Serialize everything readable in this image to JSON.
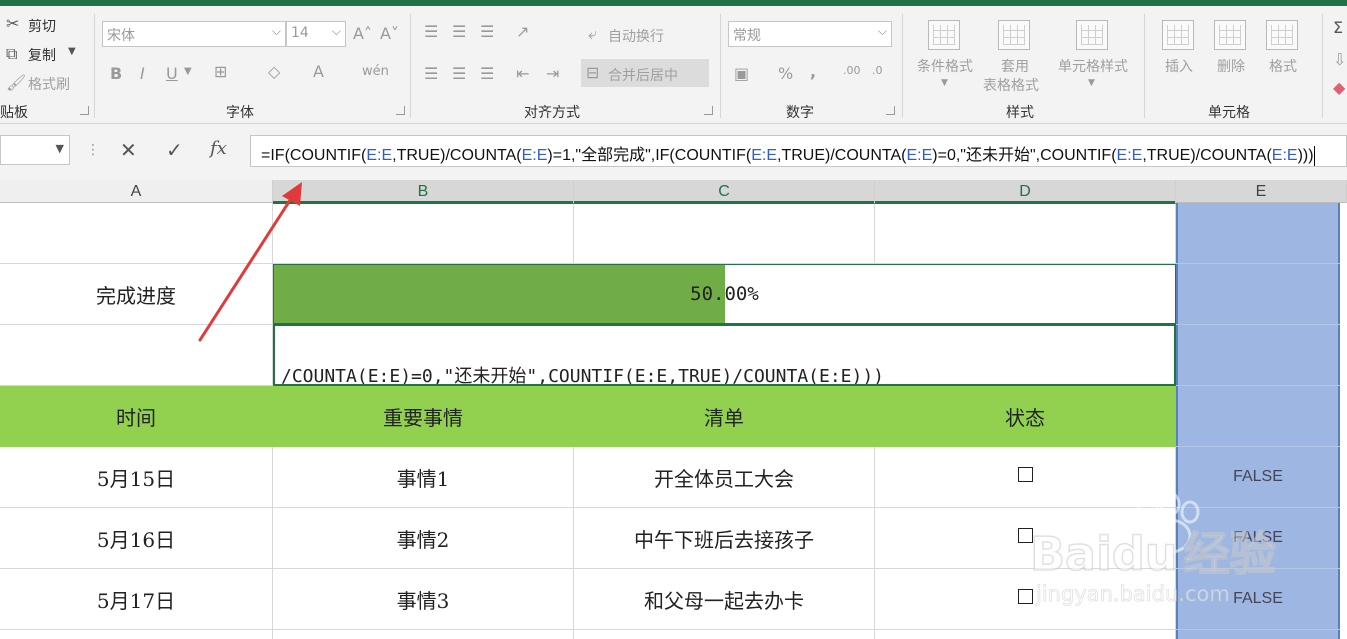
{
  "ribbon": {
    "clipboard": {
      "cut": "剪切",
      "copy": "复制",
      "format_painter": "格式刷",
      "group_label": "贴板"
    },
    "font": {
      "font_name": "宋体",
      "font_size": "14",
      "bold": "B",
      "italic": "I",
      "underline": "U",
      "font_color": "A",
      "phonetic": "wén",
      "group_label": "字体"
    },
    "alignment": {
      "wrap_text": "自动换行",
      "merge_center": "合并后居中",
      "group_label": "对齐方式"
    },
    "number": {
      "format": "常规",
      "percent": "%",
      "comma": ",",
      "group_label": "数字"
    },
    "styles": {
      "conditional_format": "条件格式",
      "table_format_line1": "套用",
      "table_format_line2": "表格格式",
      "cell_styles": "单元格样式",
      "group_label": "样式"
    },
    "cells": {
      "insert": "插入",
      "delete": "删除",
      "format": "格式",
      "group_label": "单元格"
    }
  },
  "formula_bar": {
    "fx": "fx",
    "formula_parts": [
      {
        "t": "=IF(COUNTIF(",
        "ref": false
      },
      {
        "t": "E:E",
        "ref": true
      },
      {
        "t": ",TRUE)/COUNTA(",
        "ref": false
      },
      {
        "t": "E:E",
        "ref": true
      },
      {
        "t": ")=1,\"全部完成\",IF(COUNTIF(",
        "ref": false
      },
      {
        "t": "E:E",
        "ref": true
      },
      {
        "t": ",TRUE)/COUNTA(",
        "ref": false
      },
      {
        "t": "E:E",
        "ref": true
      },
      {
        "t": ")=0,\"还未开始\",COUNTIF(",
        "ref": false
      },
      {
        "t": "E:E",
        "ref": true
      },
      {
        "t": ",TRUE)/COUNTA(",
        "ref": false
      },
      {
        "t": "E:E",
        "ref": true
      },
      {
        "t": ")))",
        "ref": false
      }
    ]
  },
  "columns": [
    "A",
    "B",
    "C",
    "D",
    "E"
  ],
  "sheet": {
    "progress_label": "完成进度",
    "progress_value": 0.5,
    "progress_text": "50.00%",
    "editing_text": "/COUNTA(E:E)=0,\"还未开始\",COUNTIF(E:E,TRUE)/COUNTA(E:E)))",
    "headers": [
      "时间",
      "重要事情",
      "清单",
      "状态"
    ],
    "rows": [
      {
        "date": "5月15日",
        "item": "事情1",
        "task": "开全体员工大会",
        "status": "FALSE"
      },
      {
        "date": "5月16日",
        "item": "事情2",
        "task": "中午下班后去接孩子",
        "status": "FALSE"
      },
      {
        "date": "5月17日",
        "item": "事情3",
        "task": "和父母一起去办卡",
        "status": "FALSE"
      }
    ]
  },
  "watermark": {
    "brand": "Baidu",
    "brand_cn": "经验",
    "url": "jingyan.baidu.com"
  },
  "colors": {
    "excel_green": "#217346",
    "header_fill": "#92d050",
    "progress_fill": "#70ad47",
    "selection": "#9db6e2",
    "arrow": "#e03a3a"
  }
}
